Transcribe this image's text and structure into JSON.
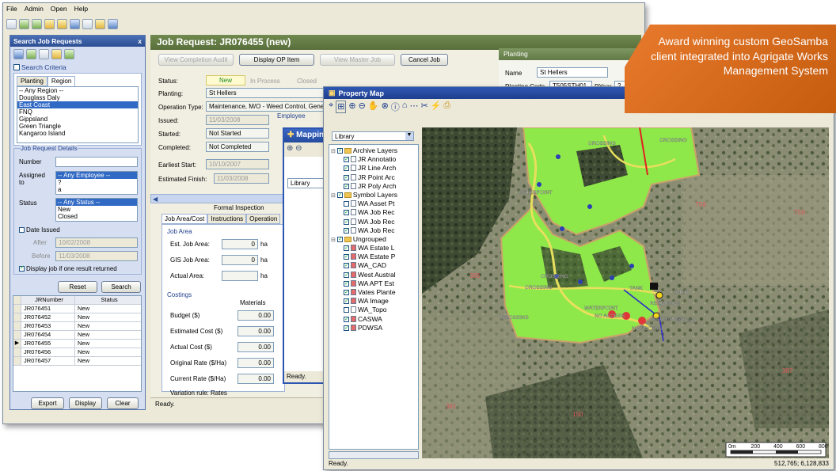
{
  "menu": [
    "File",
    "Admin",
    "Open",
    "Help"
  ],
  "left_panel": {
    "title": "Search Job Requests",
    "close": "x",
    "criteria_label": "Search Criteria",
    "tabs": [
      "Planting",
      "Region"
    ],
    "regions": [
      "-- Any Region --",
      "Douglass Daly",
      "East Coast",
      "FNQ",
      "Gippsland",
      "Green Triangle",
      "Kangaroo Island"
    ],
    "selected_region": "East Coast",
    "details_label": "Job Request Details",
    "number_label": "Number",
    "assigned_label": "Assigned to",
    "assigned_options": [
      "-- Any Employee --",
      "?",
      "a"
    ],
    "status_label": "Status",
    "status_options": [
      "-- Any Status --",
      "New",
      "Closed"
    ],
    "date_issued_label": "Date Issued",
    "after_label": "After",
    "after_value": "10/02/2008",
    "before_label": "Before",
    "before_value": "11/03/2008",
    "display_if_one": "Display job if one result returned",
    "reset": "Reset",
    "search": "Search",
    "table_headers": [
      "JRNumber",
      "Status"
    ],
    "rows": [
      {
        "num": "JR076451",
        "status": "New"
      },
      {
        "num": "JR076452",
        "status": "New"
      },
      {
        "num": "JR076453",
        "status": "New"
      },
      {
        "num": "JR076454",
        "status": "New"
      },
      {
        "num": "JR076455",
        "status": "New"
      },
      {
        "num": "JR076456",
        "status": "New"
      },
      {
        "num": "JR076457",
        "status": "New"
      }
    ],
    "export": "Export",
    "display": "Display",
    "clear": "Clear"
  },
  "main": {
    "title": "Job Request: JR076455 (new)",
    "buttons": [
      "View Completion Audit",
      "Display OP Item",
      "View Master Job",
      "Cancel Job"
    ],
    "status_label": "Status:",
    "status_steps": [
      "New",
      "In Process",
      "Closed"
    ],
    "planting_label": "Planting:",
    "planting_value": "St Hellers",
    "op_type_label": "Operation Type:",
    "op_type_value": "Maintenance, M/O - Weed Control, General",
    "issued_label": "Issued:",
    "issued_value": "11/03/2008",
    "employee_label": "Employee",
    "started_label": "Started:",
    "started_value": "Not Started",
    "completed_label": "Completed:",
    "completed_value": "Not Completed",
    "earliest_label": "Earliest Start:",
    "earliest_value": "10/10/2007",
    "est_finish_label": "Estimated Finish:",
    "est_finish_value": "11/03/2008",
    "formal_inspection": "Formal Inspection",
    "tabs": [
      "Job Area/Cost",
      "Instructions",
      "Operation"
    ],
    "job_area_label": "Job Area",
    "est_job_area": "Est. Job Area:",
    "gis_job_area": "GIS Job Area:",
    "actual_area": "Actual Area:",
    "area_value": "0",
    "ha": "ha",
    "costings": "Costings",
    "materials": "Materials",
    "cost_rows": [
      "Budget ($)",
      "Estimated Cost ($)",
      "Actual Cost ($)",
      "Original Rate ($/Ha)",
      "Current Rate ($/Ha)"
    ],
    "cost_value": "0.00",
    "variation": "Variation rule: Rates",
    "planting_panel": {
      "title": "Planting",
      "name_label": "Name",
      "name_value": "St Hellers",
      "code_label": "Planting Code",
      "code_value": "T505STH01",
      "pyear_label": "PYear",
      "pyear_value": "2"
    }
  },
  "status_bar": "Ready.",
  "mapping_popup": {
    "title": "Mapping",
    "library": "Library",
    "status": "Ready."
  },
  "property_map": {
    "title": "Property Map",
    "library": "Library",
    "layers": [
      {
        "name": "Archive Layers",
        "kind": "folder",
        "checked": true,
        "indent": 0
      },
      {
        "name": "JR Annotatio",
        "kind": "layer",
        "checked": true,
        "indent": 1
      },
      {
        "name": "JR Line Arch",
        "kind": "layer",
        "checked": true,
        "indent": 1
      },
      {
        "name": "JR Point Arc",
        "kind": "layer",
        "checked": true,
        "indent": 1
      },
      {
        "name": "JR Poly Arch",
        "kind": "layer",
        "checked": true,
        "indent": 1
      },
      {
        "name": "Symbol Layers",
        "kind": "folder",
        "checked": true,
        "indent": 0
      },
      {
        "name": "WA Asset Pt",
        "kind": "layer",
        "checked": false,
        "indent": 1
      },
      {
        "name": "WA Job Rec",
        "kind": "layer",
        "checked": true,
        "indent": 1
      },
      {
        "name": "WA Job Rec",
        "kind": "layer",
        "checked": true,
        "indent": 1
      },
      {
        "name": "WA Job Rec",
        "kind": "layer",
        "checked": true,
        "indent": 1
      },
      {
        "name": "Ungrouped",
        "kind": "folder",
        "checked": true,
        "indent": 0
      },
      {
        "name": "WA Estate L",
        "kind": "rlayer",
        "checked": true,
        "indent": 1
      },
      {
        "name": "WA Estate P",
        "kind": "rlayer",
        "checked": true,
        "indent": 1
      },
      {
        "name": "WA_CAD",
        "kind": "rlayer",
        "checked": true,
        "indent": 1
      },
      {
        "name": "West Austral",
        "kind": "rlayer",
        "checked": true,
        "indent": 1
      },
      {
        "name": "WA APT Est",
        "kind": "rlayer",
        "checked": true,
        "indent": 1
      },
      {
        "name": "Vates Plante",
        "kind": "rlayer",
        "checked": true,
        "indent": 1
      },
      {
        "name": "WA Image",
        "kind": "rlayer",
        "checked": true,
        "indent": 1
      },
      {
        "name": "WA_Topo",
        "kind": "layer",
        "checked": false,
        "indent": 1
      },
      {
        "name": "CASWA",
        "kind": "rlayer",
        "checked": true,
        "indent": 1
      },
      {
        "name": "PDWSA",
        "kind": "rlayer",
        "checked": true,
        "indent": 1
      }
    ],
    "map_labels": [
      "CROSSING",
      "CROSSING",
      "WATERPOINT",
      "CROSSING",
      "CROSSING",
      "WATERPOINT",
      "TANK",
      "RESIDENCE",
      "WATERPOINT",
      "NO ACCESS",
      "NO ACCESS",
      "CROSSING",
      "SHED",
      "ACCESS"
    ],
    "scale_labels": [
      "0m",
      "200",
      "400",
      "600",
      "800"
    ],
    "status": "Ready.",
    "coords": "512,765; 6,128,833"
  },
  "banner": "Award winning custom GeoSamba client integrated into Agrigate Works Management System",
  "colors": {
    "banner": "#de7022",
    "title_green": "#627a45",
    "map_green": "#8ee84a",
    "header_blue": "#2f58b3"
  }
}
